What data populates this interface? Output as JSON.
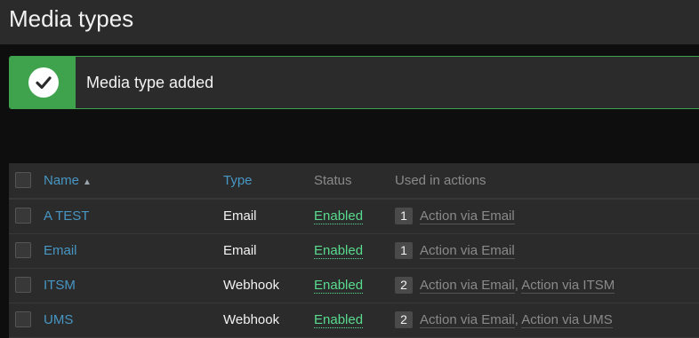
{
  "page": {
    "title": "Media types"
  },
  "alert": {
    "message": "Media type added",
    "icon": "check-icon",
    "color": "#3fa34d"
  },
  "table": {
    "columns": {
      "name": "Name",
      "sort_indicator": "▲",
      "type": "Type",
      "status": "Status",
      "used": "Used in actions"
    },
    "rows": [
      {
        "name": "A TEST",
        "type": "Email",
        "status": "Enabled",
        "count": "1",
        "actions": [
          "Action via Email"
        ]
      },
      {
        "name": "Email",
        "type": "Email",
        "status": "Enabled",
        "count": "1",
        "actions": [
          "Action via Email"
        ]
      },
      {
        "name": "ITSM",
        "type": "Webhook",
        "status": "Enabled",
        "count": "2",
        "actions": [
          "Action via Email",
          "Action via ITSM"
        ]
      },
      {
        "name": "UMS",
        "type": "Webhook",
        "status": "Enabled",
        "count": "2",
        "actions": [
          "Action via Email",
          "Action via UMS"
        ]
      }
    ]
  },
  "colors": {
    "link": "#4796c4",
    "enabled": "#59db8f",
    "background": "#2b2b2b"
  }
}
